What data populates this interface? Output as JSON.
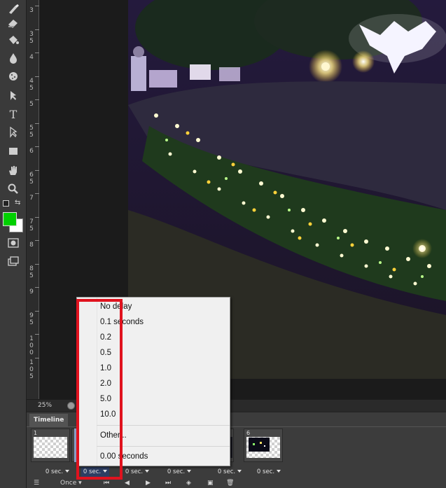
{
  "toolbar": {
    "tools": [
      {
        "icon": "brush-icon"
      },
      {
        "icon": "eraser-icon"
      },
      {
        "icon": "paint-bucket-icon"
      },
      {
        "icon": "blur-drop-icon"
      },
      {
        "icon": "sponge-icon"
      },
      {
        "icon": "pen-icon"
      },
      {
        "icon": "type-icon",
        "glyph": "T"
      },
      {
        "icon": "path-select-icon"
      },
      {
        "icon": "rectangle-icon"
      },
      {
        "icon": "hand-icon"
      },
      {
        "icon": "zoom-icon"
      }
    ],
    "foreground_color": "#00d000",
    "background_color": "#ffffff"
  },
  "ruler": {
    "labels": [
      "3",
      "3\n5",
      "4",
      "4\n5",
      "5",
      "5\n5",
      "6",
      "6\n5",
      "7",
      "7\n5",
      "8",
      "8\n5",
      "9",
      "9\n5",
      "1\n0\n0",
      "1\n0\n5"
    ]
  },
  "statusbar": {
    "zoom": "25%"
  },
  "timeline": {
    "tab_label": "Timeline",
    "frames": [
      {
        "number": "1",
        "delay": "0 sec."
      },
      {
        "number": "",
        "delay": "0 sec."
      },
      {
        "number": "",
        "delay": "0 sec."
      },
      {
        "number": "",
        "delay": "0 sec."
      },
      {
        "number": "",
        "delay": "0 sec."
      },
      {
        "number": "6",
        "delay": "0 sec."
      }
    ],
    "loop_option": "Once"
  },
  "delay_menu": {
    "items": [
      "No delay",
      "0.1 seconds",
      "0.2",
      "0.5",
      "1.0",
      "2.0",
      "5.0",
      "10.0",
      "Other...",
      "0.00 seconds"
    ]
  },
  "colors": {
    "highlight": "#e0121e",
    "menu_background": "#f0f0f0",
    "panel_background": "#3c3c3c"
  }
}
